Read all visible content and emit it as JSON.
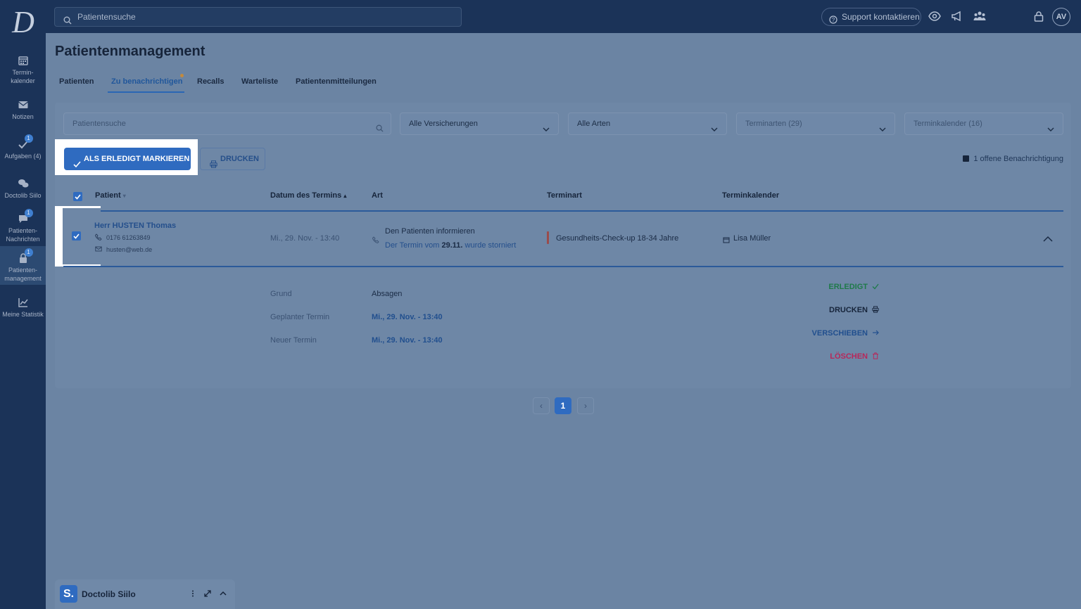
{
  "header": {
    "search_placeholder": "Patientensuche",
    "support_label": "Support kontaktieren",
    "avatar_initials": "AV"
  },
  "sidebar": {
    "items": [
      {
        "label": "Termin-\nkalender",
        "badge": ""
      },
      {
        "label": "Notizen",
        "badge": ""
      },
      {
        "label": "Aufgaben (4)",
        "badge": "1"
      },
      {
        "label": "Doctolib Siilo",
        "badge": ""
      },
      {
        "label": "Patienten-\nNachrichten",
        "badge": "1"
      },
      {
        "label": "Patienten-\nmanagement",
        "badge": "1"
      },
      {
        "label": "Meine Statistik",
        "badge": ""
      }
    ]
  },
  "main": {
    "title": "Patientenmanagement",
    "tabs": [
      "Patienten",
      "Zu benachrichtigen",
      "Recalls",
      "Warteliste",
      "Patientenmitteilungen"
    ],
    "filters": {
      "search_placeholder": "Patientensuche",
      "insurance": "Alle Versicherungen",
      "types": "Alle Arten",
      "appointment_types": "Terminarten (29)",
      "calendars": "Terminkalender (16)"
    },
    "actions": {
      "mark_done": "ALS ERLEDIGT MARKIEREN",
      "print": "DRUCKEN",
      "open_notifications": "1 offene Benachrichtigung"
    },
    "table": {
      "headers": [
        "Patient",
        "Datum des Termins",
        "Art",
        "Terminart",
        "Terminkalender"
      ],
      "row": {
        "name": "Herr HUSTEN Thomas",
        "phone": "0176 61263849",
        "email": "husten@web.de",
        "date": "Mi., 29. Nov. - 13:40",
        "art_title": "Den Patienten informieren",
        "art_sub_prefix": "Der Termin vom ",
        "art_sub_bold": "29.11.",
        "art_sub_suffix": " wurde storniert",
        "terminart": "Gesundheits-Check-up 18-34 Jahre",
        "calendar": "Lisa Müller"
      },
      "details": {
        "reason_label": "Grund",
        "reason_value": "Absagen",
        "planned_label": "Geplanter Termin",
        "planned_value": "Mi., 29. Nov. - 13:40",
        "new_label": "Neuer Termin",
        "new_value": "Mi., 29. Nov. - 13:40"
      },
      "row_actions": {
        "done": "ERLEDIGT",
        "print": "DRUCKEN",
        "move": "VERSCHIEBEN",
        "delete": "LÖSCHEN"
      }
    },
    "pager": {
      "current": "1",
      "prev": "‹",
      "next": "›"
    }
  },
  "chat": {
    "logo": "S.",
    "title": "Doctolib Siilo"
  },
  "colors": {
    "accent": "#2f6bc0",
    "nav": "#1b3358",
    "done": "#1f7a4a",
    "delete": "#b8275a"
  }
}
